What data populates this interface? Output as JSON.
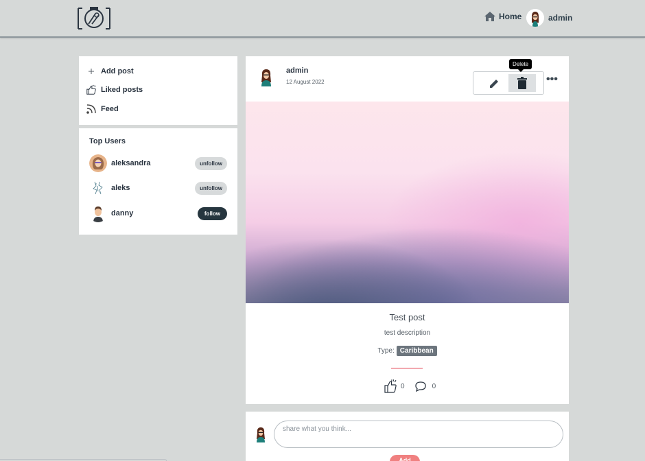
{
  "nav": {
    "home_label": "Home",
    "user_label": "admin"
  },
  "menu": {
    "items": [
      {
        "label": "Add post",
        "icon": "plus-icon"
      },
      {
        "label": "Liked posts",
        "icon": "thumbs-up-icon"
      },
      {
        "label": "Feed",
        "icon": "rss-icon"
      }
    ]
  },
  "top_users": {
    "title": "Top Users",
    "users": [
      {
        "name": "aleksandra",
        "action": "unfollow"
      },
      {
        "name": "aleks",
        "action": "unfollow"
      },
      {
        "name": "danny",
        "action": "follow"
      }
    ]
  },
  "post": {
    "author": "admin",
    "date": "12 August 2022",
    "tooltip": "Delete",
    "more": "•••",
    "title": "Test post",
    "description": "test description",
    "type_label": "Type:",
    "type_value": "Caribbean",
    "likes": "0",
    "comments": "0"
  },
  "comment_box": {
    "placeholder": "share what you think...",
    "button": "Add"
  },
  "colors": {
    "background": "#d6d9d8",
    "follow_button": "#26363f",
    "type_badge": "#6c757d",
    "accent_pink": "#f08080"
  }
}
